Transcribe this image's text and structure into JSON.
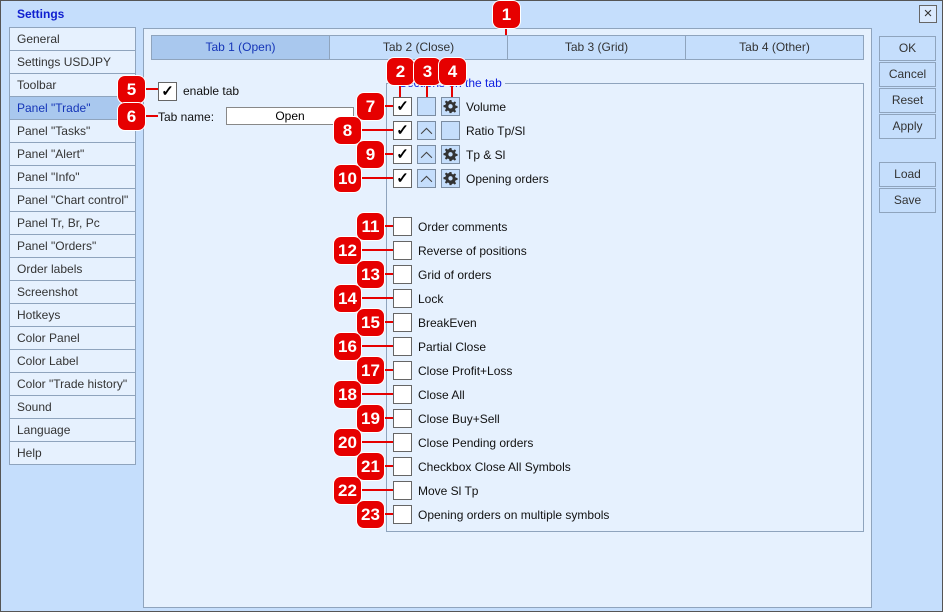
{
  "window": {
    "title": "Settings",
    "close_icon": "close-icon"
  },
  "sidebar": {
    "items": [
      "General",
      "Settings USDJPY",
      "Toolbar",
      "Panel \"Trade\"",
      "Panel \"Tasks\"",
      "Panel \"Alert\"",
      "Panel \"Info\"",
      "Panel \"Chart control\"",
      "Panel Tr, Br, Pc",
      "Panel \"Orders\"",
      "Order labels",
      "Screenshot",
      "Hotkeys",
      "Color Panel",
      "Color Label",
      "Color \"Trade history\"",
      "Sound",
      "Language",
      "Help"
    ],
    "active": 3
  },
  "tabs": {
    "items": [
      "Tab 1 (Open)",
      "Tab 2 (Close)",
      "Tab 3 (Grid)",
      "Tab 4 (Other)"
    ],
    "active": 0
  },
  "enable_tab": {
    "label": "enable tab",
    "checked": true
  },
  "tab_name": {
    "label": "Tab name:",
    "value": "Open"
  },
  "sections": {
    "title": "Sections on the tab",
    "top": [
      {
        "label": "Volume",
        "checked": true,
        "arrow": false,
        "gear": true
      },
      {
        "label": "Ratio Tp/Sl",
        "checked": true,
        "arrow": true,
        "gear": false
      },
      {
        "label": "Tp & Sl",
        "checked": true,
        "arrow": true,
        "gear": true
      },
      {
        "label": "Opening orders",
        "checked": true,
        "arrow": true,
        "gear": true
      }
    ],
    "bottom": [
      "Order comments",
      "Reverse of positions",
      "Grid of orders",
      "Lock",
      "BreakEven",
      "Partial Close",
      "Close Profit+Loss",
      "Close All",
      "Close Buy+Sell",
      "Close Pending orders",
      "Checkbox Close All Symbols",
      "Move Sl Tp",
      "Opening orders on multiple symbols"
    ]
  },
  "buttons": {
    "ok": "OK",
    "cancel": "Cancel",
    "reset": "Reset",
    "apply": "Apply",
    "load": "Load",
    "save": "Save"
  },
  "badges": [
    "1",
    "2",
    "3",
    "4",
    "5",
    "6",
    "7",
    "8",
    "9",
    "10",
    "11",
    "12",
    "13",
    "14",
    "15",
    "16",
    "17",
    "18",
    "19",
    "20",
    "21",
    "22",
    "23"
  ],
  "colors": {
    "accent": "#1535b8",
    "badge": "#e60000",
    "background": "#c5defc"
  }
}
